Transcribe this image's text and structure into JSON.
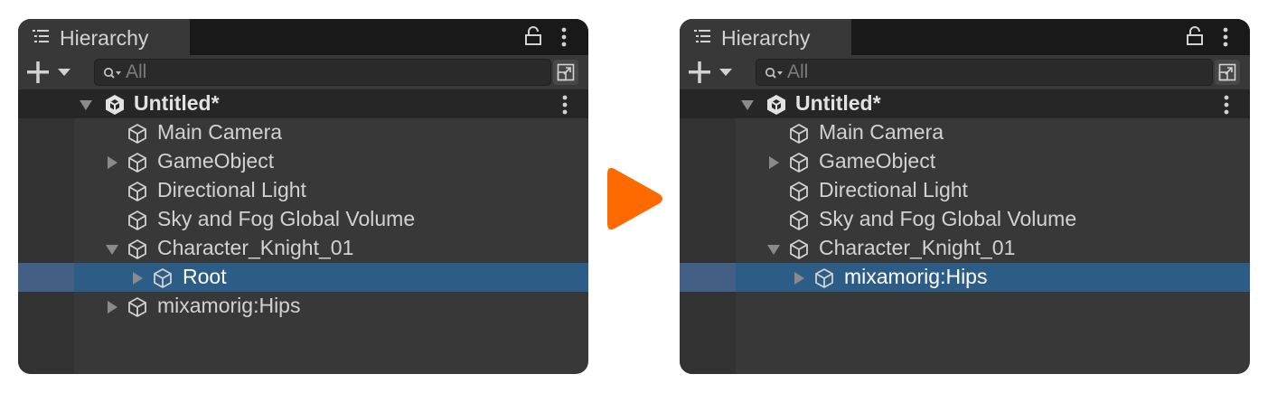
{
  "left": {
    "tab_title": "Hierarchy",
    "search_placeholder": "All",
    "scene_name": "Untitled*",
    "items": [
      {
        "label": "Main Camera"
      },
      {
        "label": "GameObject"
      },
      {
        "label": "Directional Light"
      },
      {
        "label": "Sky and Fog Global Volume"
      },
      {
        "label": "Character_Knight_01"
      },
      {
        "label": "Root"
      },
      {
        "label": "mixamorig:Hips"
      }
    ]
  },
  "right": {
    "tab_title": "Hierarchy",
    "search_placeholder": "All",
    "scene_name": "Untitled*",
    "items": [
      {
        "label": "Main Camera"
      },
      {
        "label": "GameObject"
      },
      {
        "label": "Directional Light"
      },
      {
        "label": "Sky and Fog Global Volume"
      },
      {
        "label": "Character_Knight_01"
      },
      {
        "label": "mixamorig:Hips"
      }
    ]
  },
  "colors": {
    "panel_bg": "#383838",
    "tabbar_bg": "#191919",
    "scene_row_bg": "#262626",
    "selection": "#2c5d87",
    "arrow_accent": "#ff6a00"
  },
  "icons": [
    "list-icon",
    "lock-icon",
    "more-icon",
    "add-icon",
    "search-icon",
    "window-icon",
    "unity-scene-icon",
    "cube-icon",
    "expand-arrow-icon",
    "collapse-arrow-icon",
    "play-arrow-icon"
  ]
}
